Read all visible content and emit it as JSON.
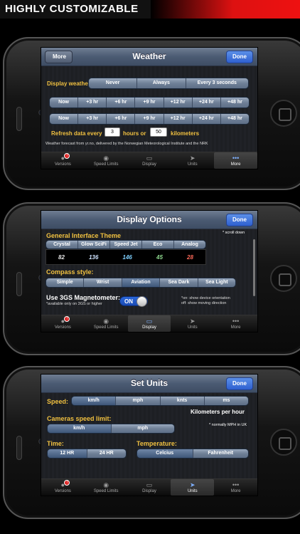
{
  "banner": {
    "title": "HIGHLY CUSTOMIZABLE"
  },
  "tabs": [
    "Versions",
    "Speed Limits",
    "Display",
    "Units",
    "More"
  ],
  "tab_badge": "!",
  "weather": {
    "title": "Weather",
    "back": "More",
    "done": "Done",
    "display_label": "Display weather:",
    "display_options": [
      "Never",
      "Always",
      "Every 3 seconds"
    ],
    "row1": [
      "Now",
      "+3 hr",
      "+6 hr",
      "+9 hr",
      "+12 hr",
      "+24 hr",
      "+48 hr"
    ],
    "row2": [
      "Now",
      "+3 hr",
      "+6 hr",
      "+9 hr",
      "+12 hr",
      "+24 hr",
      "+48 hr"
    ],
    "refresh_label": "Refresh data every",
    "hours_value": "3",
    "hours_or": "hours or",
    "km_value": "50",
    "km_label": "kilometers",
    "credit": "Weather forecast from yr.no, delivered by the Norwegian Meteorological Institute and the NRK"
  },
  "display": {
    "title": "Display Options",
    "done": "Done",
    "theme_label": "General Interface Theme",
    "scroll_hint": "* scroll down",
    "themes": [
      "Crystal",
      "Glow SciFi",
      "Speed Jet",
      "Eco",
      "Analog"
    ],
    "theme_samples": [
      "82",
      "136",
      "146",
      "45",
      "28"
    ],
    "compass_label": "Compass style:",
    "compass_options": [
      "Simple",
      "Wrist",
      "Aviation",
      "Sea Dark",
      "Sea Light"
    ],
    "magnet_label": "Use 3GS Magnetometer:",
    "magnet_note": "*available only on 3GS or higher",
    "toggle": "ON",
    "on_note": "*on: show device orientation",
    "off_note": "off: show moving direction"
  },
  "units": {
    "title": "Set Units",
    "done": "Done",
    "speed_label": "Speed:",
    "speed_options": [
      "km/h",
      "mph",
      "knts",
      "ms"
    ],
    "speed_caption": "Kilometers per hour",
    "camera_label": "Cameras speed limit:",
    "camera_options": [
      "km/h",
      "mph"
    ],
    "camera_note": "* normally MPH in UK",
    "time_label": "Time:",
    "time_options": [
      "12 HR",
      "24 HR"
    ],
    "temp_label": "Temperature:",
    "temp_options": [
      "Celcius",
      "Fahrenheit"
    ]
  }
}
